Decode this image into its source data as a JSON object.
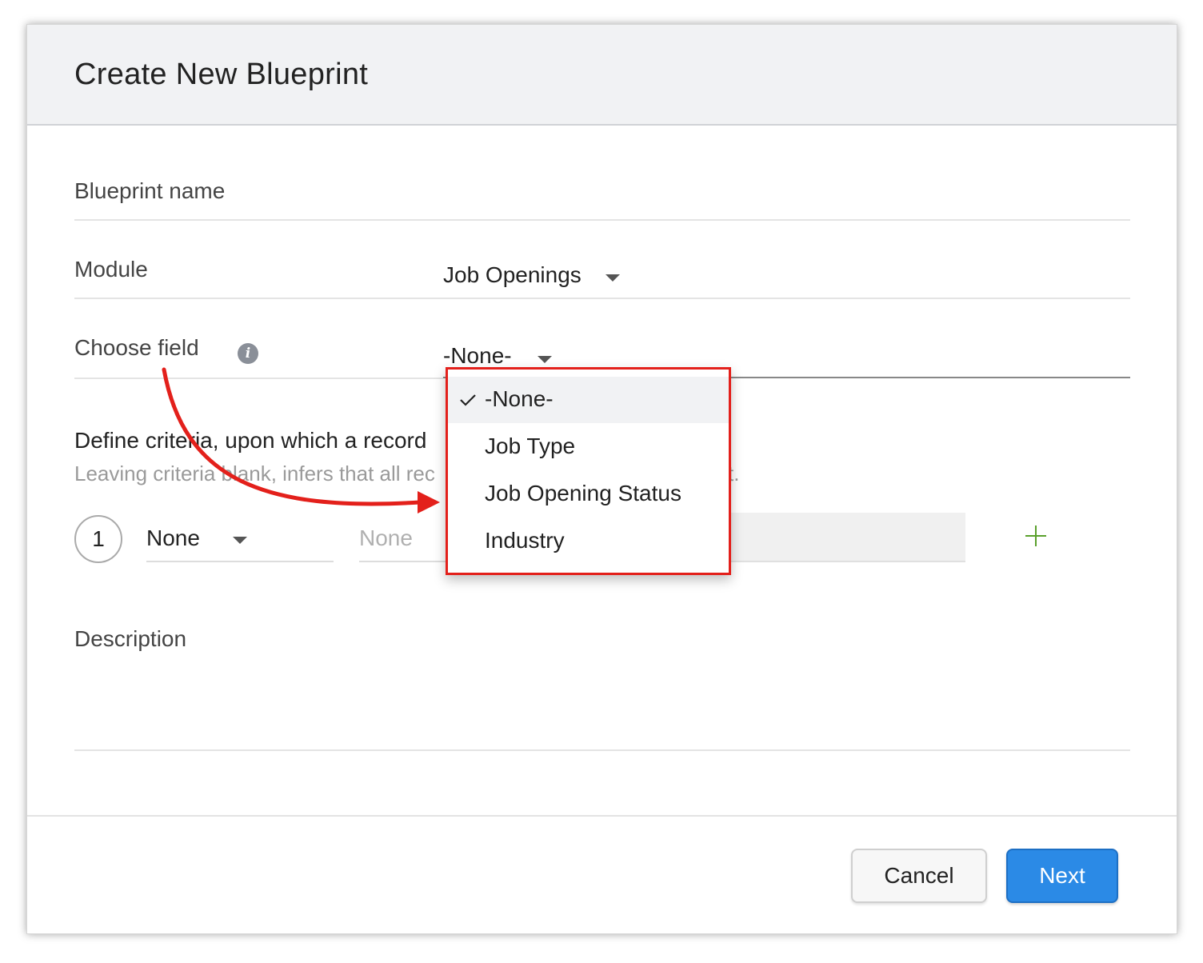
{
  "dialog": {
    "title": "Create New Blueprint",
    "fields": {
      "blueprint_name_label": "Blueprint name",
      "module_label": "Module",
      "module_value": "Job Openings",
      "choose_field_label": "Choose field",
      "choose_field_value": "-None-"
    },
    "criteria": {
      "title": "Define criteria, upon which a record",
      "subtitle": "Leaving criteria blank, infers that all rec",
      "subtitle_tail": "t.",
      "row_number": "1",
      "field_value": "None",
      "operator_placeholder": "None"
    },
    "description_label": "Description",
    "buttons": {
      "cancel": "Cancel",
      "next": "Next"
    }
  },
  "dropdown": {
    "items": [
      {
        "label": "-None-",
        "selected": true
      },
      {
        "label": "Job Type",
        "selected": false
      },
      {
        "label": "Job Opening Status",
        "selected": false
      },
      {
        "label": "Industry",
        "selected": false
      }
    ]
  },
  "icons": {
    "info": "info-icon",
    "caret": "chevron-down-icon",
    "check": "check-icon",
    "plus": "plus-icon"
  },
  "colors": {
    "highlight": "#e3201b",
    "primary_button": "#2b8ae6",
    "plus": "#5aa02c"
  }
}
